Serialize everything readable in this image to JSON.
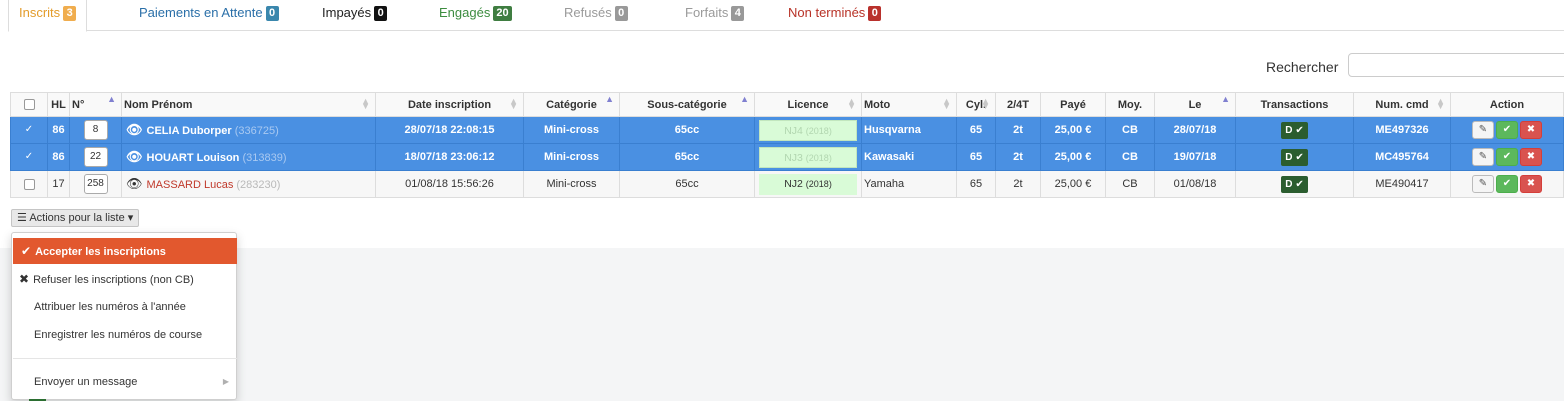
{
  "tabs": [
    {
      "label": "Inscrits",
      "count": "3",
      "color": "#e39c2b",
      "badge": "#f0ad4e",
      "active": true
    },
    {
      "label": "Paiements en Attente",
      "count": "0",
      "color": "#2a6fa8",
      "badge": "#3a87ad",
      "active": false
    },
    {
      "label": "Impayés",
      "count": "0",
      "color": "#222222",
      "badge": "#111111",
      "active": false
    },
    {
      "label": "Engagés",
      "count": "20",
      "color": "#3c8c3f",
      "badge": "#3f7d41",
      "active": false
    },
    {
      "label": "Refusés",
      "count": "0",
      "color": "#9a9a9a",
      "badge": "#999999",
      "active": false
    },
    {
      "label": "Forfaits",
      "count": "4",
      "color": "#9a9a9a",
      "badge": "#999999",
      "active": false
    },
    {
      "label": "Non terminés",
      "count": "0",
      "color": "#b83227",
      "badge": "#b9312c",
      "active": false
    }
  ],
  "search": {
    "label": "Rechercher",
    "value": ""
  },
  "table": {
    "headers": {
      "hl": "HL",
      "num": "N°",
      "name": "Nom Prénom",
      "date": "Date inscription",
      "categorie": "Catégorie",
      "sous_categorie": "Sous-catégorie",
      "licence": "Licence",
      "moto": "Moto",
      "cyl": "Cyl.",
      "temps": "2/4T",
      "paye": "Payé",
      "moy": "Moy.",
      "le": "Le",
      "transactions": "Transactions",
      "num_cmd": "Num. cmd",
      "action": "Action"
    },
    "rows": [
      {
        "selected": true,
        "check": "✓",
        "hl": "86",
        "num": "8",
        "name": "CELIA Duborper",
        "id": "(336725)",
        "date": "28/07/18 22:08:15",
        "categorie": "Mini-cross",
        "sous_categorie": "65cc",
        "licence": "NJ4",
        "licence_year": "(2018)",
        "moto": "Husqvarna",
        "cyl": "65",
        "temps": "2t",
        "paye": "25,00 €",
        "moy": "CB",
        "le": "28/07/18",
        "transactions": "D",
        "num_cmd": "ME497326"
      },
      {
        "selected": true,
        "check": "✓",
        "hl": "86",
        "num": "22",
        "name": "HOUART Louison",
        "id": "(313839)",
        "date": "18/07/18 23:06:12",
        "categorie": "Mini-cross",
        "sous_categorie": "65cc",
        "licence": "NJ3",
        "licence_year": "(2018)",
        "moto": "Kawasaki",
        "cyl": "65",
        "temps": "2t",
        "paye": "25,00 €",
        "moy": "CB",
        "le": "19/07/18",
        "transactions": "D",
        "num_cmd": "MC495764"
      },
      {
        "selected": false,
        "check": "",
        "hl": "17",
        "num": "258",
        "name": "MASSARD Lucas",
        "id": "(283230)",
        "date": "01/08/18 15:56:26",
        "categorie": "Mini-cross",
        "sous_categorie": "65cc",
        "licence": "NJ2",
        "licence_year": "(2018)",
        "moto": "Yamaha",
        "cyl": "65",
        "temps": "2t",
        "paye": "25,00 €",
        "moy": "CB",
        "le": "01/08/18",
        "transactions": "D",
        "num_cmd": "ME490417"
      }
    ]
  },
  "actions_button": {
    "label": "Actions pour la liste"
  },
  "menu": {
    "accept": "Accepter les inscriptions",
    "refuse": "Refuser les inscriptions (non CB)",
    "attribuer": "Attribuer les numéros à l'année",
    "enregistrer": "Enregistrer les numéros de course",
    "message": "Envoyer un message"
  },
  "colors": {
    "selected_row": "#4a90e2",
    "menu_active": "#e2582e",
    "transaction": "#2b5d2f"
  }
}
